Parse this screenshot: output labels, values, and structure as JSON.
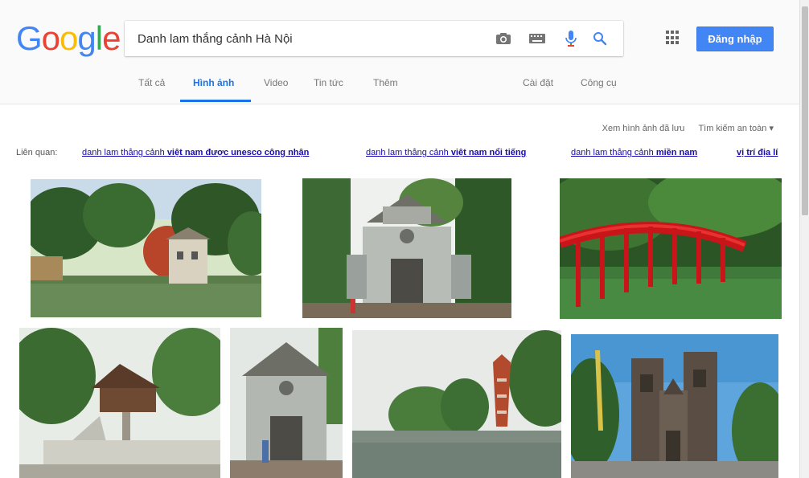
{
  "logo": {
    "letters": [
      "G",
      "o",
      "o",
      "g",
      "l",
      "e"
    ],
    "colors": [
      "#4285f4",
      "#ea4335",
      "#fbbc05",
      "#4285f4",
      "#34a853",
      "#ea4335"
    ]
  },
  "search": {
    "query": "Danh lam thắng cảnh Hà Nội"
  },
  "icons": {
    "camera": "camera-icon",
    "keyboard": "keyboard-icon",
    "mic": "mic-icon",
    "search": "search-icon",
    "apps": "apps-grid-icon"
  },
  "header": {
    "signin_label": "Đăng nhập"
  },
  "tabs": [
    {
      "label": "Tất cả"
    },
    {
      "label": "Hình ảnh"
    },
    {
      "label": "Video"
    },
    {
      "label": "Tin tức"
    },
    {
      "label": "Thêm"
    },
    {
      "label": "Cài đặt"
    },
    {
      "label": "Công cụ"
    }
  ],
  "tools": {
    "saved_images": "Xem hình ảnh đã lưu",
    "safe_search": "Tìm kiếm an toàn ▾"
  },
  "related": {
    "label": "Liên quan:",
    "items": [
      {
        "prefix": "danh lam thắng cảnh ",
        "bold": "việt nam được unesco công nhận"
      },
      {
        "prefix": "danh lam thắng cảnh ",
        "bold": "việt nam nổi tiếng"
      },
      {
        "prefix": "danh lam thắng cảnh ",
        "bold": "miền nam"
      },
      {
        "prefix": "",
        "bold": "vị trí địa lí"
      }
    ]
  },
  "accent_color": "#4285f4"
}
